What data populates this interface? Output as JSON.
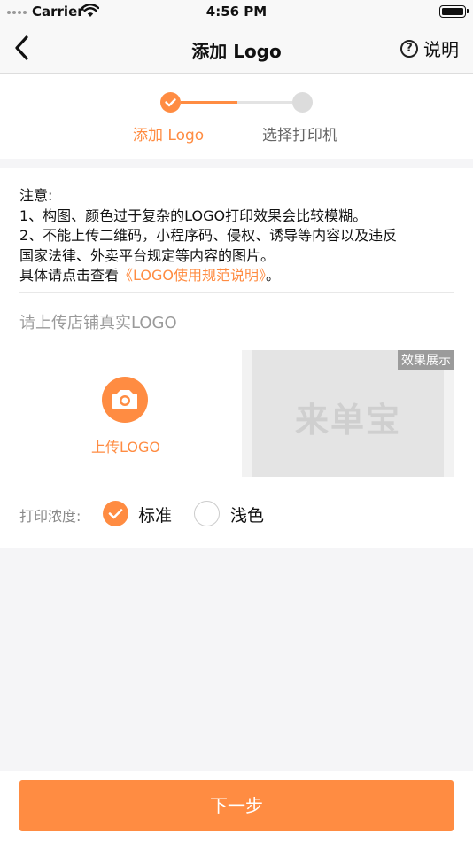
{
  "status_bar": {
    "carrier": "Carrier",
    "time": "4:56 PM"
  },
  "nav": {
    "title": "添加 Logo",
    "help_label": "说明",
    "help_glyph": "?"
  },
  "steps": [
    {
      "label": "添加 Logo",
      "state": "done"
    },
    {
      "label": "选择打印机",
      "state": "todo"
    }
  ],
  "notes": {
    "heading": "注意:",
    "line1": "1、构图、颜色过于复杂的LOGO打印效果会比较模糊。",
    "line2a": "2、不能上传二维码，小程序码、侵权、诱导等内容以及违反",
    "line2b": "国家法律、外卖平台规定等内容的图片。",
    "line3_prefix": "具体请点击查看",
    "line3_link": "《LOGO使用规范说明》",
    "line3_suffix": "。"
  },
  "upload": {
    "hint": "请上传店铺真实LOGO",
    "button_label": "上传LOGO"
  },
  "preview": {
    "badge": "效果展示",
    "watermark": "来单宝"
  },
  "density": {
    "label": "打印浓度:",
    "options": [
      {
        "label": "标准",
        "selected": true
      },
      {
        "label": "浅色",
        "selected": false
      }
    ]
  },
  "footer": {
    "next_label": "下一步"
  },
  "colors": {
    "accent": "#ff8c42",
    "inactive": "#dcdcdc"
  }
}
